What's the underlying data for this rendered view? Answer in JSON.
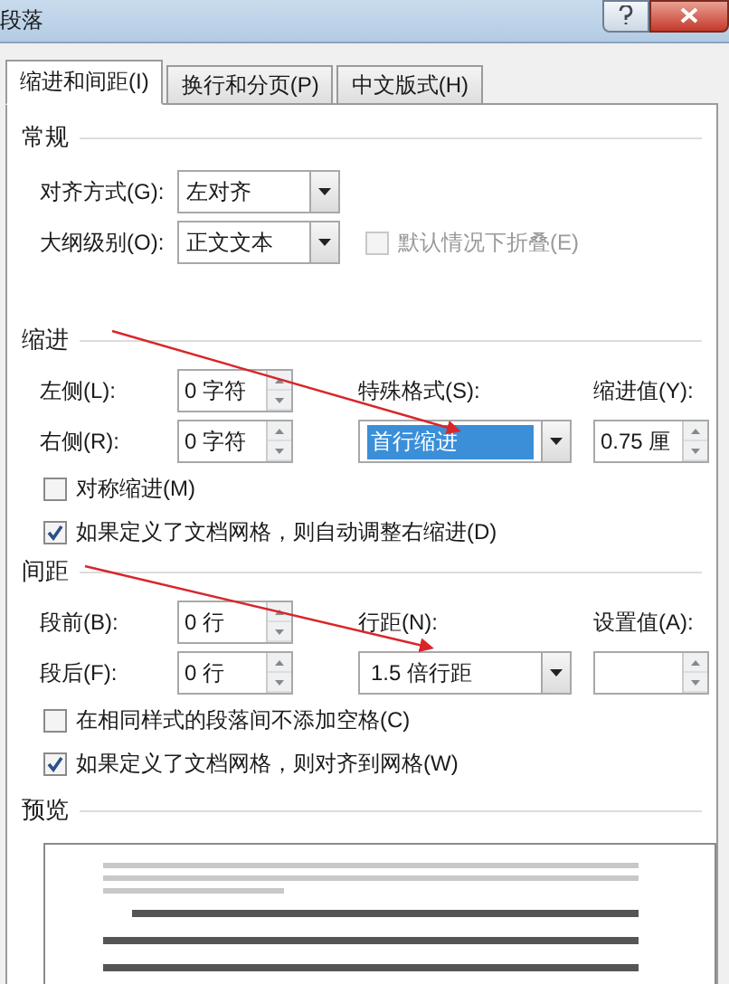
{
  "window": {
    "title": "段落"
  },
  "tabs": [
    {
      "label": "缩进和间距(I)",
      "selected": true
    },
    {
      "label": "换行和分页(P)",
      "selected": false
    },
    {
      "label": "中文版式(H)",
      "selected": false
    }
  ],
  "general": {
    "title": "常规",
    "fields": [
      {
        "label": "对齐方式(G):",
        "value": "左对齐"
      },
      {
        "label": "大纲级别(O):",
        "value": "正文文本"
      }
    ],
    "collapse": {
      "label": "默认情况下折叠(E)",
      "checked": false,
      "disabled": true
    }
  },
  "indent": {
    "title": "缩进",
    "left": {
      "label": "左侧(L):",
      "value": "0 字符"
    },
    "right": {
      "label": "右侧(R):",
      "value": "0 字符"
    },
    "special": {
      "label": "特殊格式(S):",
      "value": "首行缩进",
      "selected": true
    },
    "by": {
      "label": "缩进值(Y):",
      "value": "0.75 厘"
    },
    "options": [
      {
        "label": "对称缩进(M)",
        "checked": false
      },
      {
        "label": "如果定义了文档网格，则自动调整右缩进(D)",
        "checked": true
      }
    ]
  },
  "spacing": {
    "title": "间距",
    "before": {
      "label": "段前(B):",
      "value": "0 行"
    },
    "after": {
      "label": "段后(F):",
      "value": "0 行"
    },
    "line": {
      "label": "行距(N):",
      "value": "1.5 倍行距",
      "selected": false
    },
    "at": {
      "label": "设置值(A):"
    },
    "options": [
      {
        "label": "在相同样式的段落间不添加空格(C)",
        "checked": false
      },
      {
        "label": "如果定义了文档网格，则对齐到网格(W)",
        "checked": true
      }
    ]
  },
  "preview": {
    "title": "预览"
  },
  "annotations": [
    {
      "kind": "arrow"
    },
    {
      "kind": "arrow"
    }
  ]
}
